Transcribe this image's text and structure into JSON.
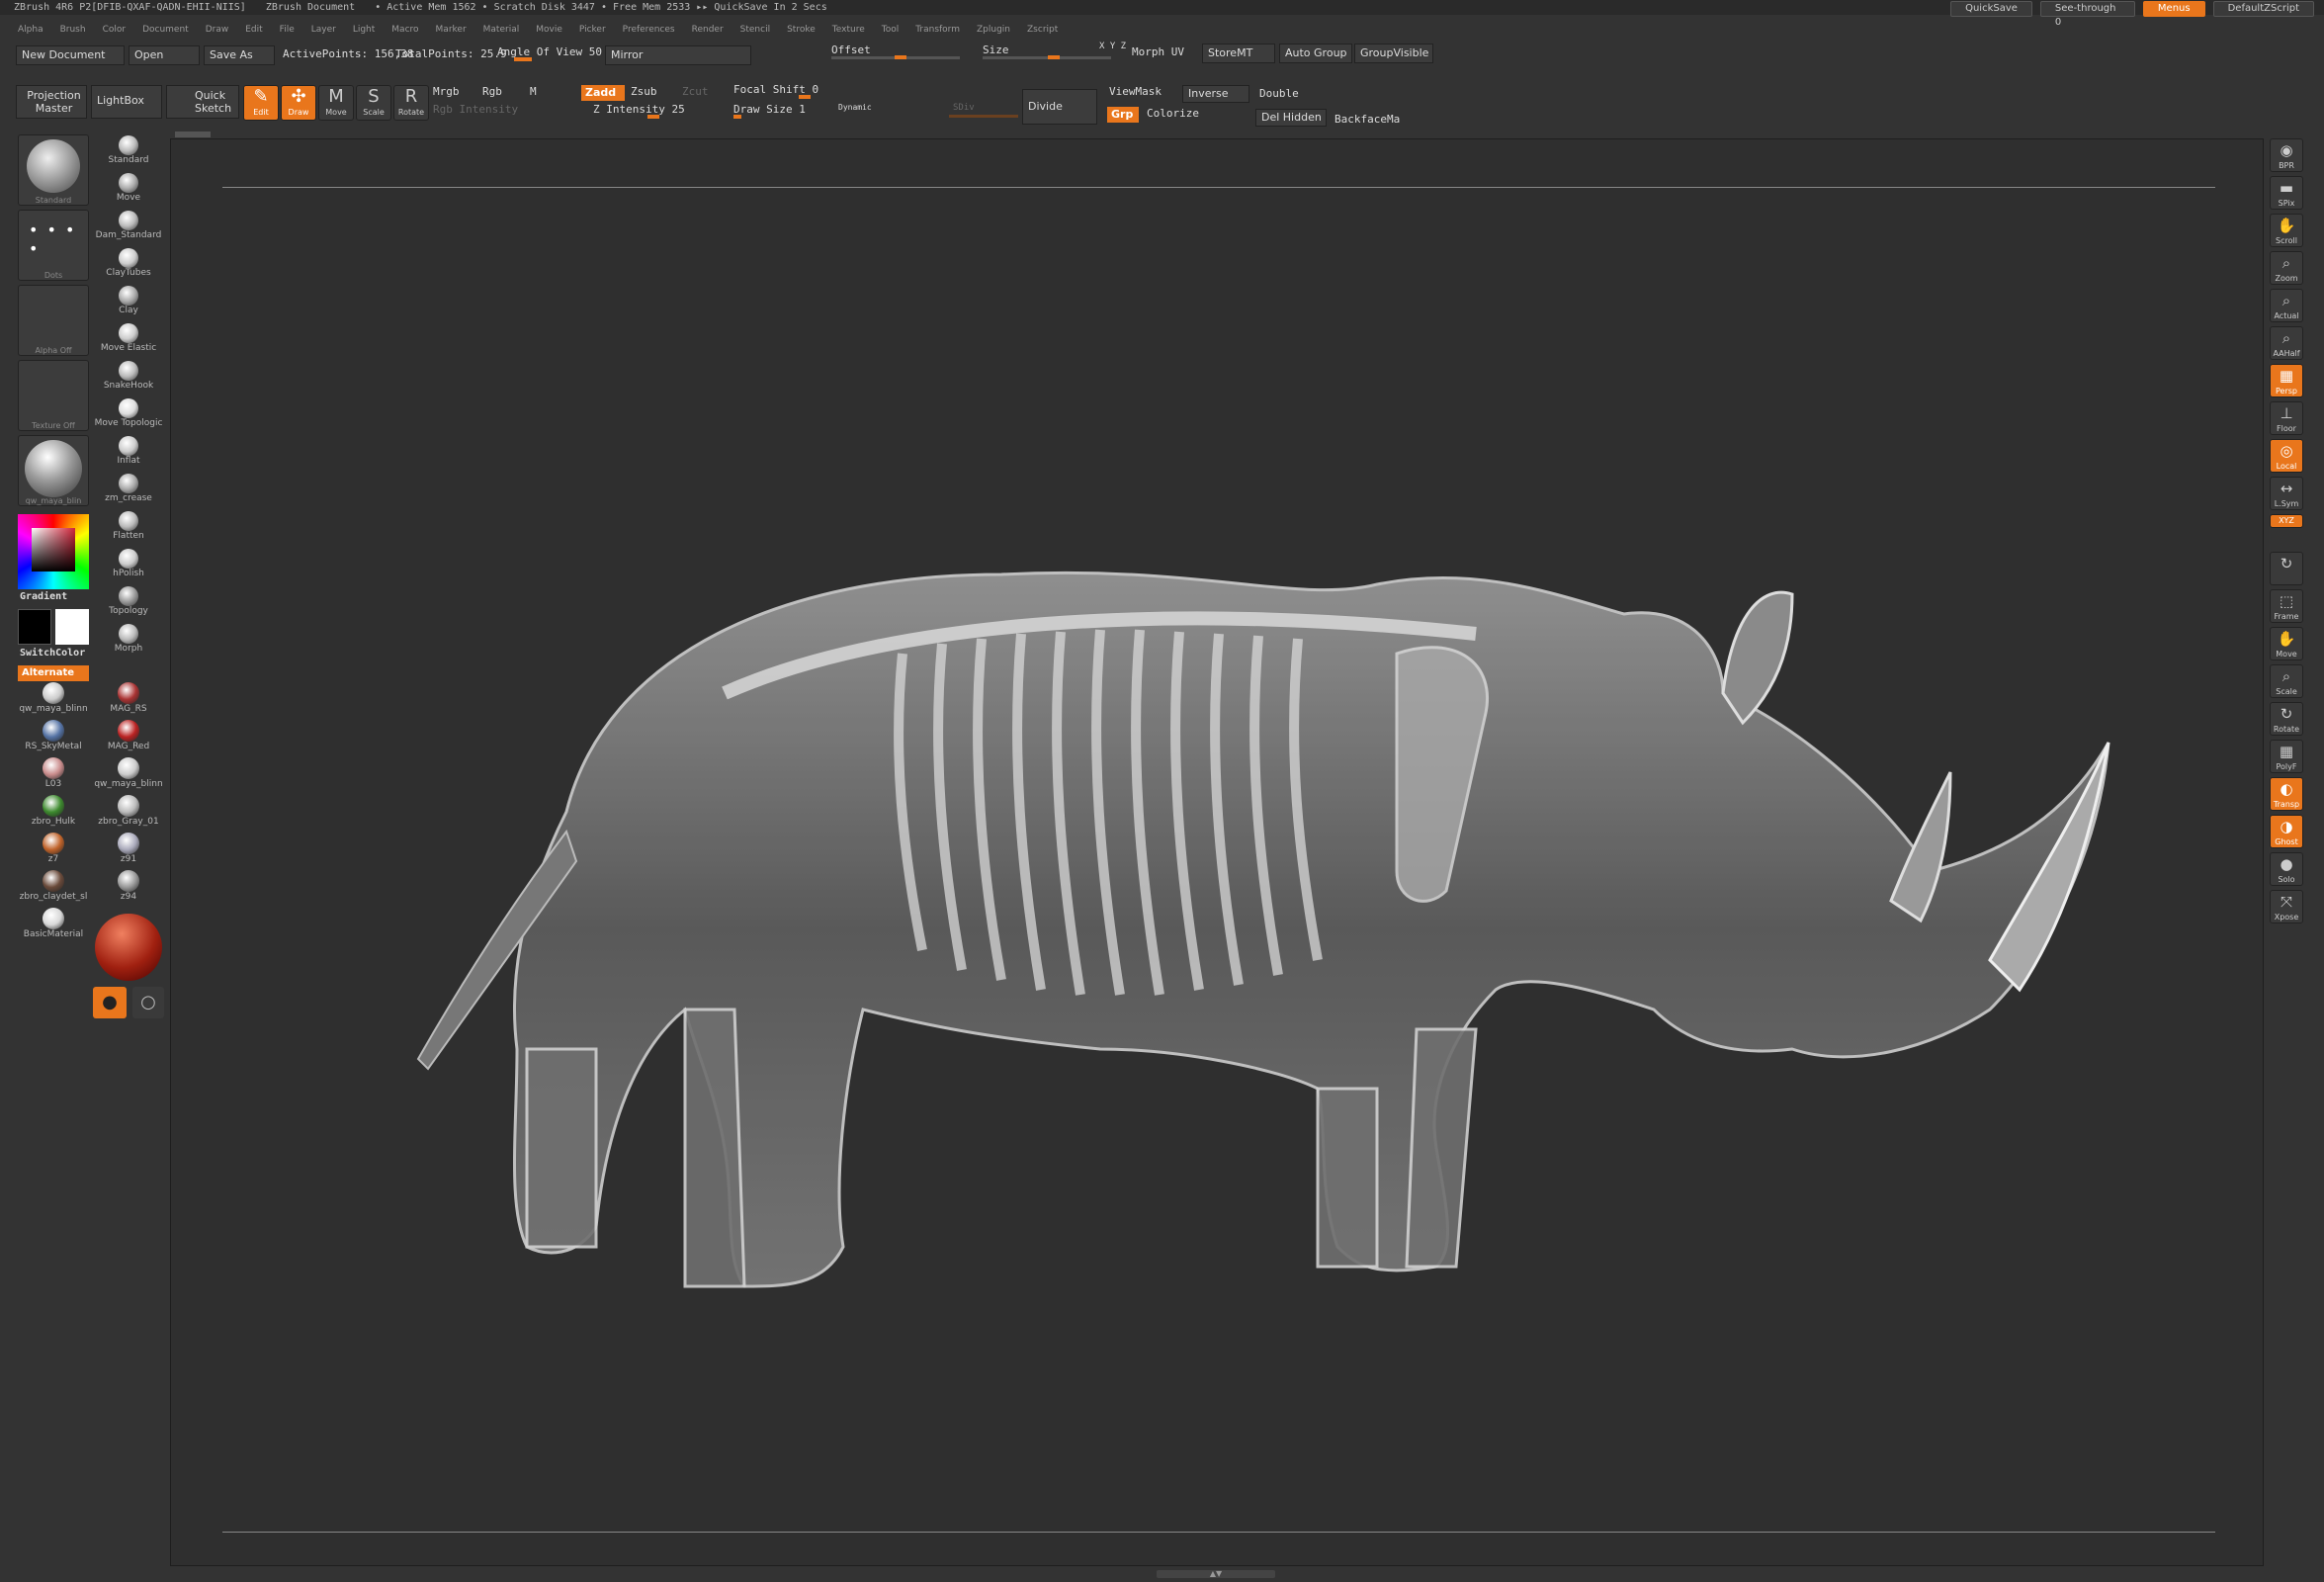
{
  "titlebar": {
    "app": "ZBrush 4R6  P2[DFIB-QXAF-QADN-EHII-NIIS]",
    "doc": "ZBrush Document",
    "stats": "• Active Mem 1562  • Scratch Disk 3447  • Free Mem 2533  ▸▸ QuickSave In 2 Secs",
    "quicksave": "QuickSave",
    "seethrough": "See-through  0",
    "menus": "Menus",
    "script": "DefaultZScript"
  },
  "menubar": [
    "Alpha",
    "Brush",
    "Color",
    "Document",
    "Draw",
    "Edit",
    "File",
    "Layer",
    "Light",
    "Macro",
    "Marker",
    "Material",
    "Movie",
    "Picker",
    "Preferences",
    "Render",
    "Stencil",
    "Stroke",
    "Texture",
    "Tool",
    "Transform",
    "Zplugin",
    "Zscript"
  ],
  "toolbar1": {
    "new_doc": "New Document",
    "open": "Open",
    "save_as": "Save As",
    "active_points": "ActivePoints: 156,38",
    "total_points": "TotalPoints: 25.9",
    "angle_of_view": "Angle Of View 50",
    "mirror": "Mirror",
    "offset": "Offset",
    "size": "Size",
    "xyz": "X Y Z",
    "morph_uv": "Morph UV",
    "storemt": "StoreMT",
    "auto_group": "Auto Group",
    "group_visible": "GroupVisible"
  },
  "toolbar2": {
    "projection_master": [
      "Projection",
      "Master"
    ],
    "lightbox": "LightBox",
    "quick_sketch": [
      "Quick",
      "Sketch"
    ],
    "edit": "Edit",
    "draw": "Draw",
    "move": "Move",
    "scale": "Scale",
    "rotate": "Rotate",
    "mrgb": "Mrgb",
    "rgb": "Rgb",
    "m": "M",
    "rgb_intensity": "Rgb Intensity",
    "zadd": "Zadd",
    "zsub": "Zsub",
    "zcut": "Zcut",
    "z_intensity": "Z Intensity 25",
    "focal_shift": "Focal Shift 0",
    "draw_size": "Draw Size 1",
    "dynamic": "Dynamic",
    "sdiv": "SDiv",
    "divide": "Divide",
    "viewmask": "ViewMask",
    "inverse": "Inverse",
    "double": "Double",
    "grp": "Grp",
    "colorize": "Colorize",
    "del_hidden": "Del Hidden",
    "backface": "BackfaceMa"
  },
  "leftpanel": {
    "tiles": [
      "Standard",
      "Dots",
      "Alpha Off",
      "Texture Off",
      "qw_maya_blin"
    ],
    "gradient": "Gradient",
    "switchcolor": "SwitchColor",
    "alternate": "Alternate",
    "materials_left": [
      "qw_maya_blinn",
      "RS_SkyMetal",
      "L03",
      "zbro_Hulk",
      "z7",
      "zbro_claydet_sl",
      "BasicMaterial"
    ],
    "brushes": [
      "Standard",
      "Move",
      "Dam_Standard",
      "ClayTubes",
      "Clay",
      "Move Elastic",
      "SnakeHook",
      "Move Topologic",
      "Inflat",
      "zm_crease",
      "Flatten",
      "hPolish",
      "Topology",
      "Morph"
    ],
    "materials_right": [
      "MAG_RS",
      "MAG_Red",
      "qw_maya_blinn",
      "zbro_Gray_01",
      "z91",
      "z94"
    ]
  },
  "rightbar": [
    "BPR",
    "SPix",
    "Scroll",
    "Zoom",
    "Actual",
    "AAHalf",
    "Persp",
    "Floor",
    "Local",
    "L.Sym",
    "XYZ",
    "",
    "Frame",
    "Move",
    "Scale",
    "Rotate",
    "PolyF",
    "Transp",
    "Ghost",
    "Solo",
    "Xpose"
  ],
  "colors": {
    "accent": "#e9761c",
    "panel": "#3a3a3a",
    "viewport": "#2f2f2f"
  }
}
